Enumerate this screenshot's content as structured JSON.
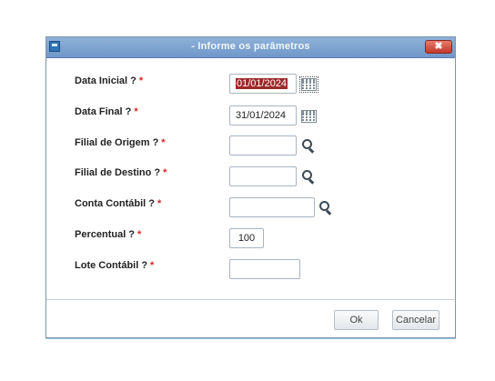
{
  "dialog": {
    "title": "- Informe os parâmetros",
    "close_symbol": "✖",
    "required_marker": "*",
    "fields": [
      {
        "label": "Data Inicial ?",
        "value": "01/01/2024",
        "selected": true,
        "icon": "calendar-icon"
      },
      {
        "label": "Data Final ?",
        "value": "31/01/2024",
        "icon": "calendar-icon"
      },
      {
        "label": "Filial de Origem ?",
        "value": "",
        "icon": "search-icon"
      },
      {
        "label": "Filial de Destino ?",
        "value": "",
        "icon": "search-icon"
      },
      {
        "label": "Conta Contábil ?",
        "value": "",
        "icon": "search-icon"
      },
      {
        "label": "Percentual ?",
        "value": "100"
      },
      {
        "label": "Lote Contábil ?",
        "value": ""
      }
    ],
    "buttons": {
      "ok": "Ok",
      "cancel": "Cancelar"
    }
  },
  "colors": {
    "titlebar": "#7fa6d2",
    "required": "#dd2222",
    "selection": "#9c2a2a",
    "close_button": "#c3392a"
  }
}
